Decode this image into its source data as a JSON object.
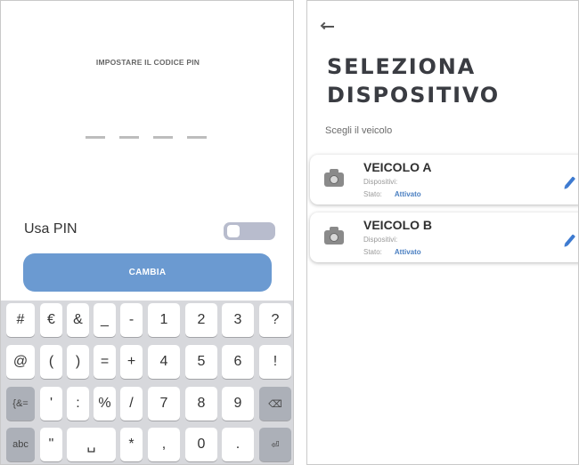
{
  "pin_screen": {
    "title": "IMPOSTARE IL CODICE PIN",
    "usa_pin_label": "Usa PIN",
    "usa_pin_enabled": false,
    "cambia_label": "CAMBIA"
  },
  "keyboard": {
    "rows": [
      [
        "#",
        "€",
        "&",
        "_",
        "-",
        "1",
        "2",
        "3",
        "?"
      ],
      [
        "@",
        "(",
        ")",
        "=",
        "+",
        "4",
        "5",
        "6",
        "!"
      ],
      [
        "{&=",
        "'",
        ":",
        "%",
        "/",
        "7",
        "8",
        "9",
        "⌫"
      ],
      [
        "abc",
        "\"",
        "␣",
        "*",
        ",",
        "0",
        ".",
        "⏎"
      ]
    ]
  },
  "device_screen": {
    "title_line1": "SELEZIONA",
    "title_line2": "DISPOSITIVO",
    "subtitle": "Scegli il veicolo",
    "vehicles": [
      {
        "name": "VEICOLO A",
        "devices_label": "Dispositivi:",
        "state_label": "Stato:",
        "state_value": "Attivato"
      },
      {
        "name": "VEICOLO B",
        "devices_label": "Dispositivi:",
        "state_label": "Stato:",
        "state_value": "Attivato"
      }
    ]
  },
  "icons": [
    "back-arrow-icon",
    "camera-icon",
    "pencil-edit-icon",
    "backspace-icon",
    "enter-icon",
    "space-icon"
  ],
  "colors": {
    "accent": "#6b9ad1",
    "toggle_off": "#b8bccd",
    "edit_icon": "#3d7ad0",
    "status": "#4a7fc1"
  }
}
